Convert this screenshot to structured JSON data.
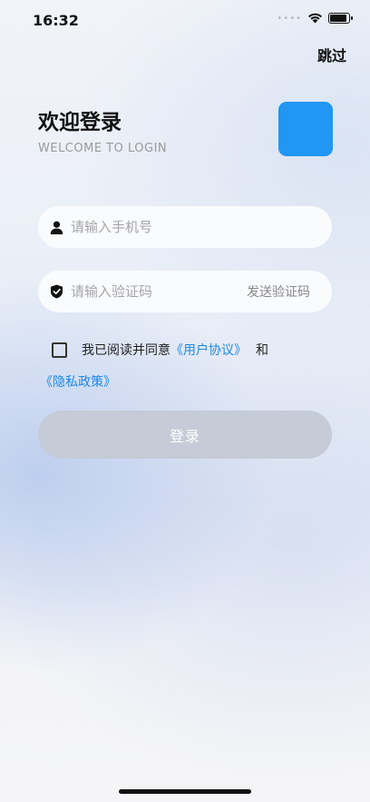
{
  "status_bar": {
    "time": "16:32",
    "signal_dots": "••••",
    "battery_level": 0.9
  },
  "header": {
    "skip_label": "跳过"
  },
  "welcome": {
    "title": "欢迎登录",
    "subtitle": "WELCOME TO LOGIN",
    "logo_color": "#2196f3"
  },
  "form": {
    "phone": {
      "placeholder": "请输入手机号",
      "value": "",
      "icon": "user-icon"
    },
    "code": {
      "placeholder": "请输入验证码",
      "value": "",
      "icon": "shield-icon",
      "send_label": "发送验证码"
    }
  },
  "agreement": {
    "checked": false,
    "prefix": "我已阅读并同意",
    "user_agreement": "《用户协议》",
    "and": "和",
    "privacy_policy": "《隐私政策》",
    "link_color": "#1e88e5"
  },
  "login_button": {
    "label": "登录"
  }
}
